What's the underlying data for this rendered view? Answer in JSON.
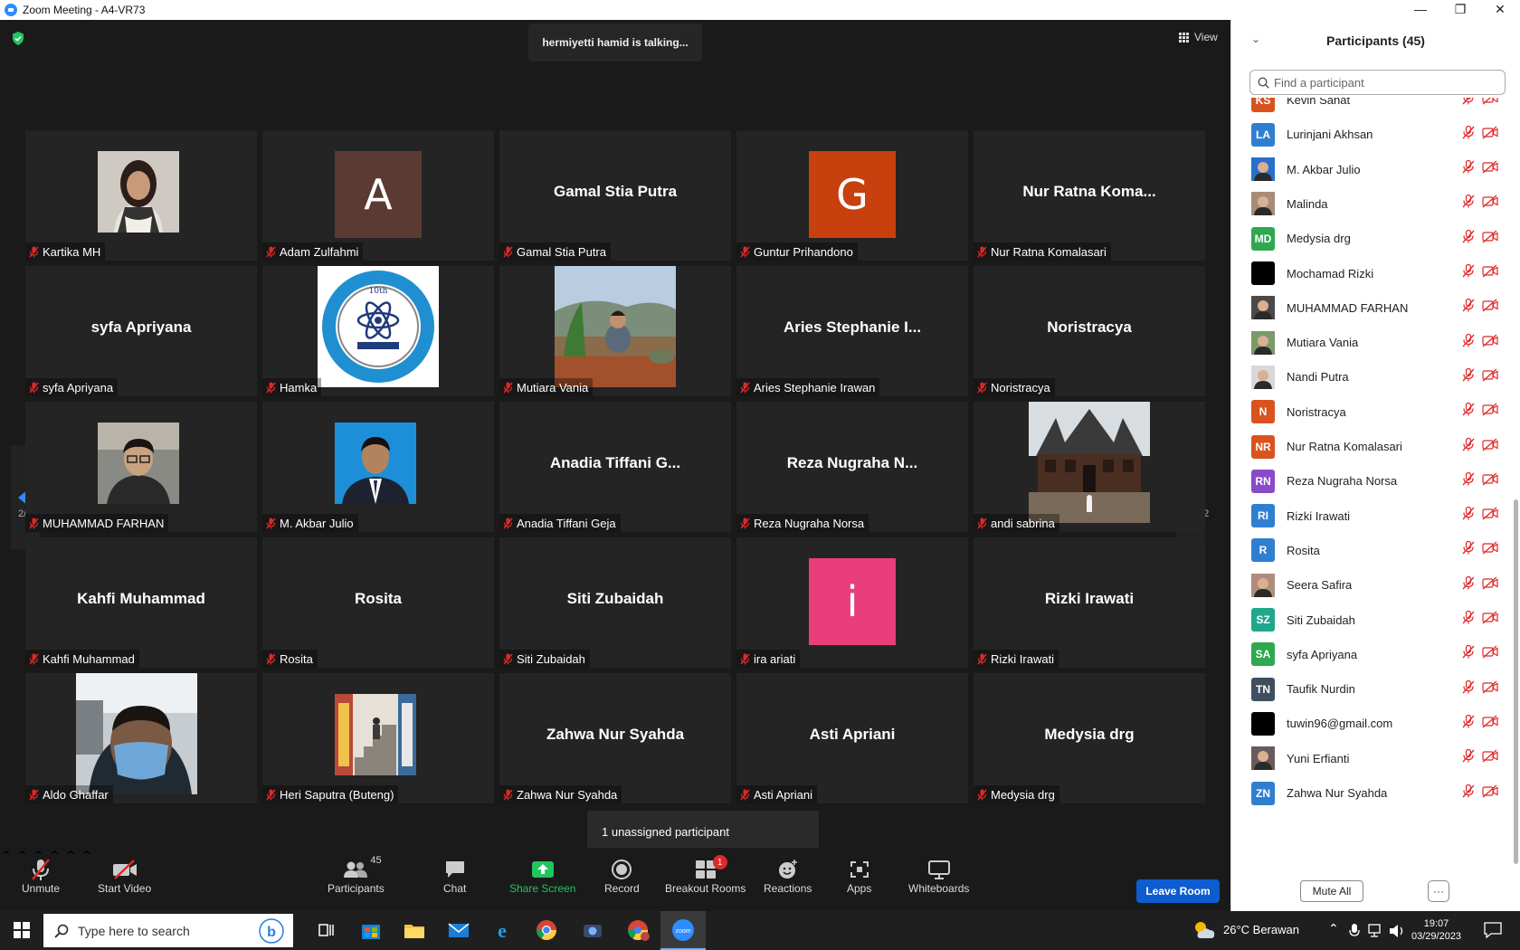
{
  "window": {
    "title": "Zoom Meeting - A4-VR73",
    "minimize": "—",
    "restore": "❐",
    "close": "✕"
  },
  "meeting": {
    "talking": "hermiyetti hamid is talking...",
    "view_label": "View",
    "page_left": "2/2",
    "page_right": "2/2",
    "unassigned": "1 unassigned participant",
    "tiles": [
      {
        "name": "Kartika MH",
        "type": "photo",
        "photo": "woman"
      },
      {
        "name": "Adam Zulfahmi",
        "type": "letter",
        "letter": "A",
        "color": "#5b3a33"
      },
      {
        "name": "Gamal Stia Putra",
        "type": "text",
        "big": "Gamal Stia Putra"
      },
      {
        "name": "Guntur Prihandono",
        "type": "letter",
        "letter": "G",
        "color": "#c8400e"
      },
      {
        "name": "Nur Ratna Komalasari",
        "type": "text",
        "big": "Nur Ratna Koma..."
      },
      {
        "name": "syfa Apriyana",
        "type": "text",
        "big": "syfa Apriyana"
      },
      {
        "name": "Hamka",
        "type": "photo",
        "photo": "badge"
      },
      {
        "name": "Mutiara Vania",
        "type": "photo",
        "photo": "landscape"
      },
      {
        "name": "Aries Stephanie Irawan",
        "type": "text",
        "big": "Aries Stephanie I..."
      },
      {
        "name": "Noristracya",
        "type": "text",
        "big": "Noristracya"
      },
      {
        "name": "MUHAMMAD FARHAN",
        "type": "photo",
        "photo": "man-glasses"
      },
      {
        "name": "M. Akbar Julio",
        "type": "photo",
        "photo": "man-suit"
      },
      {
        "name": "Anadia Tiffani Geja",
        "type": "text",
        "big": "Anadia Tiffani G..."
      },
      {
        "name": "Reza Nugraha Norsa",
        "type": "text",
        "big": "Reza Nugraha N..."
      },
      {
        "name": "andi sabrina",
        "type": "photo",
        "photo": "house"
      },
      {
        "name": "Kahfi Muhammad",
        "type": "text",
        "big": "Kahfi Muhammad"
      },
      {
        "name": "Rosita",
        "type": "text",
        "big": "Rosita"
      },
      {
        "name": "Siti Zubaidah",
        "type": "text",
        "big": "Siti Zubaidah"
      },
      {
        "name": "ira ariati",
        "type": "letter",
        "letter": "i",
        "color": "#e83e7b"
      },
      {
        "name": "Rizki Irawati",
        "type": "text",
        "big": "Rizki Irawati"
      },
      {
        "name": "Aldo Ghaffar",
        "type": "photo",
        "photo": "mask"
      },
      {
        "name": "Heri Saputra (Buteng)",
        "type": "photo",
        "photo": "stairs"
      },
      {
        "name": "Zahwa Nur Syahda",
        "type": "text",
        "big": "Zahwa Nur Syahda"
      },
      {
        "name": "Asti Apriani",
        "type": "text",
        "big": "Asti Apriani"
      },
      {
        "name": "Medysia drg",
        "type": "text",
        "big": "Medysia drg"
      }
    ]
  },
  "toolbar": {
    "unmute": "Unmute",
    "start_video": "Start Video",
    "participants": "Participants",
    "participants_count": "45",
    "chat": "Chat",
    "share_screen": "Share Screen",
    "record": "Record",
    "breakout_rooms": "Breakout Rooms",
    "breakout_badge": "1",
    "reactions": "Reactions",
    "apps": "Apps",
    "whiteboards": "Whiteboards",
    "leave_room": "Leave Room"
  },
  "panel": {
    "title": "Participants (45)",
    "search_placeholder": "Find a participant",
    "mute_all": "Mute All",
    "more": "···",
    "participants": [
      {
        "name": "Kevin Sahat",
        "initials": "KS",
        "color": "#d9531e",
        "kind": "initials"
      },
      {
        "name": "Lurinjani Akhsan",
        "initials": "LA",
        "color": "#2f7fd1",
        "kind": "initials"
      },
      {
        "name": "M. Akbar Julio",
        "initials": "",
        "color": "#2a6fc9",
        "kind": "photo"
      },
      {
        "name": "Malinda",
        "initials": "",
        "color": "#a88c7a",
        "kind": "photo"
      },
      {
        "name": "Medysia drg",
        "initials": "MD",
        "color": "#2fa84f",
        "kind": "initials"
      },
      {
        "name": "Mochamad Rizki",
        "initials": "",
        "color": "#000000",
        "kind": "photo"
      },
      {
        "name": "MUHAMMAD FARHAN",
        "initials": "",
        "color": "#4a4a4a",
        "kind": "photo"
      },
      {
        "name": "Mutiara Vania",
        "initials": "",
        "color": "#7a9a6a",
        "kind": "photo"
      },
      {
        "name": "Nandi Putra",
        "initials": "",
        "color": "#d8d8d8",
        "kind": "photo"
      },
      {
        "name": "Noristracya",
        "initials": "N",
        "color": "#d9531e",
        "kind": "initials"
      },
      {
        "name": "Nur Ratna Komalasari",
        "initials": "NR",
        "color": "#d9531e",
        "kind": "initials"
      },
      {
        "name": "Reza Nugraha Norsa",
        "initials": "RN",
        "color": "#8a4bc9",
        "kind": "initials"
      },
      {
        "name": "Rizki Irawati",
        "initials": "RI",
        "color": "#2f7fd1",
        "kind": "initials"
      },
      {
        "name": "Rosita",
        "initials": "R",
        "color": "#2f7fd1",
        "kind": "initials"
      },
      {
        "name": "Seera Safira",
        "initials": "",
        "color": "#b08d7a",
        "kind": "photo"
      },
      {
        "name": "Siti Zubaidah",
        "initials": "SZ",
        "color": "#1fa88a",
        "kind": "initials"
      },
      {
        "name": "syfa Apriyana",
        "initials": "SA",
        "color": "#2fa84f",
        "kind": "initials"
      },
      {
        "name": "Taufik Nurdin",
        "initials": "TN",
        "color": "#3f4f5f",
        "kind": "initials"
      },
      {
        "name": "tuwin96@gmail.com",
        "initials": "",
        "color": "#000000",
        "kind": "photo"
      },
      {
        "name": "Yuni Erfianti",
        "initials": "",
        "color": "#6a5a5a",
        "kind": "photo"
      },
      {
        "name": "Zahwa Nur Syahda",
        "initials": "ZN",
        "color": "#2f7fd1",
        "kind": "initials"
      }
    ]
  },
  "taskbar": {
    "search_placeholder": "Type here to search",
    "weather": "26°C  Berawan",
    "time": "19:07",
    "date": "03/29/2023"
  }
}
